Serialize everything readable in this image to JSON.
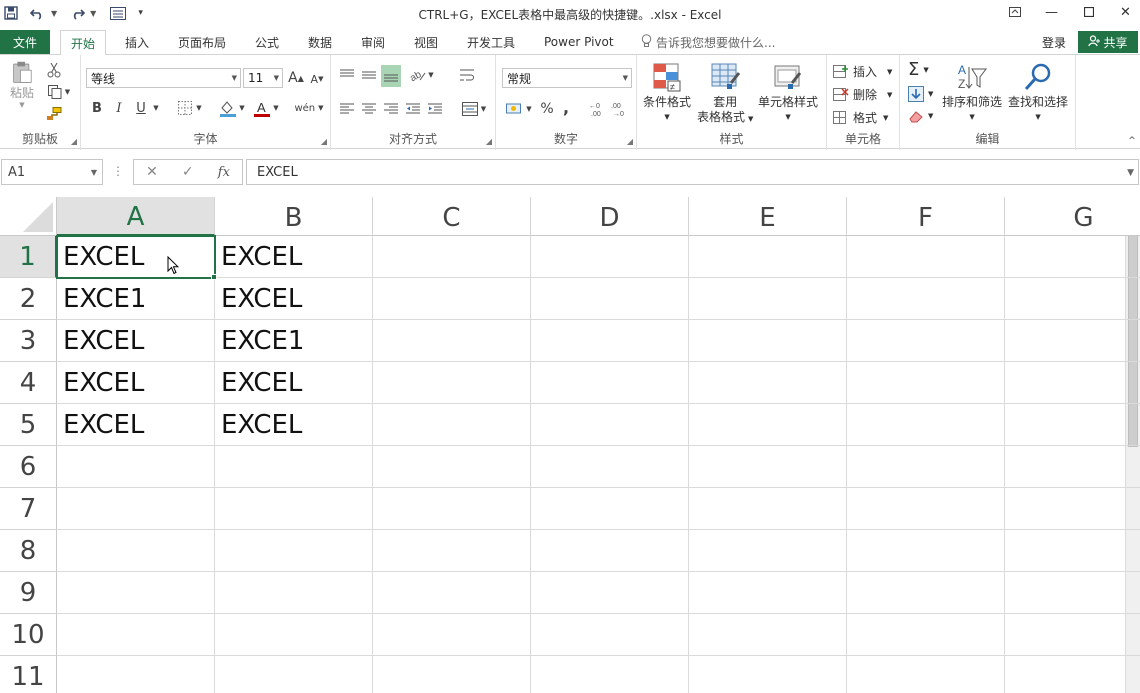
{
  "window": {
    "title": "CTRL+G，EXCEL表格中最高级的快捷键。.xlsx - Excel"
  },
  "tabs": {
    "file": "文件",
    "items": [
      "开始",
      "插入",
      "页面布局",
      "公式",
      "数据",
      "审阅",
      "视图",
      "开发工具",
      "Power Pivot"
    ],
    "tell_me": "告诉我您想要做什么...",
    "login": "登录",
    "share": "共享"
  },
  "ribbon": {
    "clipboard": {
      "label": "剪贴板",
      "paste": "粘贴"
    },
    "font": {
      "label": "字体",
      "name": "等线",
      "size": "11",
      "bold": "B",
      "italic": "I",
      "underline": "U",
      "grow": "A",
      "shrink": "A",
      "phonetic": "wén"
    },
    "alignment": {
      "label": "对齐方式"
    },
    "number": {
      "label": "数字",
      "format": "常规",
      "percent": "%",
      "comma": ","
    },
    "styles": {
      "label": "样式",
      "conditional": "条件格式",
      "table1": "套用",
      "table2": "表格格式",
      "cell_styles": "单元格样式"
    },
    "cells": {
      "label": "单元格",
      "insert": "插入",
      "delete": "删除",
      "format": "格式"
    },
    "editing": {
      "label": "编辑",
      "sort": "排序和筛选",
      "find": "查找和选择",
      "sigma": "Σ"
    }
  },
  "formula_bar": {
    "name_box": "A1",
    "fx": "fx",
    "content": "EXCEL"
  },
  "sheet": {
    "columns": [
      "A",
      "B",
      "C",
      "D",
      "E",
      "F",
      "G"
    ],
    "rows": [
      "1",
      "2",
      "3",
      "4",
      "5",
      "6",
      "7",
      "8",
      "9",
      "10",
      "11"
    ],
    "cells": [
      [
        "EXCEL",
        "EXCEL"
      ],
      [
        "EXCE1",
        "EXCEL"
      ],
      [
        "EXCEL",
        "EXCE1"
      ],
      [
        "EXCEL",
        "EXCEL"
      ],
      [
        "EXCEL",
        "EXCEL"
      ]
    ],
    "active_cell": "A1"
  },
  "colors": {
    "accent": "#217346",
    "header_selected": "#e1e1e1",
    "gridline": "#dadada"
  }
}
